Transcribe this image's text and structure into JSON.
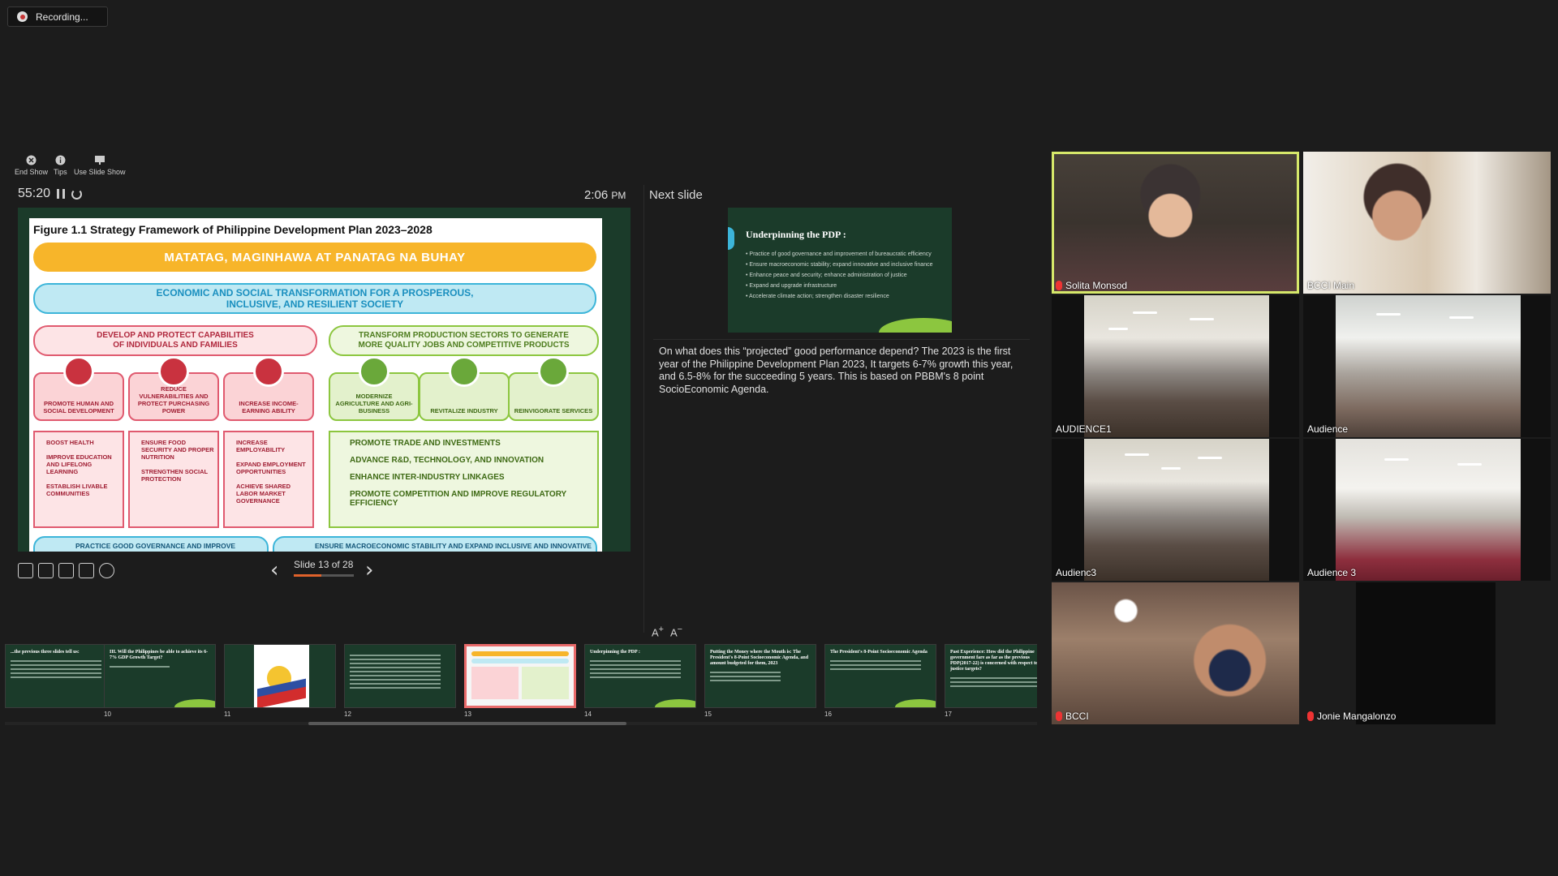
{
  "recording": {
    "label": "Recording..."
  },
  "toolbar": {
    "end_show": "End Show",
    "tips": "Tips",
    "use_slide_show": "Use Slide Show"
  },
  "timer": {
    "elapsed": "55:20"
  },
  "clock": {
    "time": "2:06",
    "ampm": "PM"
  },
  "next_slide": {
    "label": "Next slide",
    "title": "Underpinning the PDP :",
    "bullets": [
      "Practice of good governance and improvement of bureaucratic efficiency",
      "Ensure macroeconomic stability; expand innovative and inclusive finance",
      "Enhance peace and security;  enhance administration of justice",
      "Expand and upgrade infrastructure",
      "Accelerate climate action; strengthen disaster resilience"
    ]
  },
  "notes": "On what does this “projected” good performance depend?  The 2023 is the first year of the Philippine Development Plan 2023,  It targets 6-7% growth this year, and 6.5-8% for the succeeding 5 years.  This is based on PBBM's 8 point SocioEconomic Agenda.",
  "current_slide": {
    "figure_title": "Figure 1.1 Strategy Framework of Philippine Development Plan 2023–2028",
    "vision": "MATATAG, MAGINHAWA AT PANATAG NA BUHAY",
    "goal_line1": "ECONOMIC AND SOCIAL TRANSFORMATION FOR A PROSPEROUS,",
    "goal_line2": "INCLUSIVE, AND RESILIENT SOCIETY",
    "left_pillar_line1": "DEVELOP AND PROTECT CAPABILITIES",
    "left_pillar_line2": "OF INDIVIDUALS AND FAMILIES",
    "right_pillar_line1": "TRANSFORM PRODUCTION SECTORS TO GENERATE",
    "right_pillar_line2": "MORE QUALITY JOBS AND COMPETITIVE PRODUCTS",
    "categories": [
      "PROMOTE HUMAN AND SOCIAL DEVELOPMENT",
      "REDUCE VULNERABILITIES AND PROTECT PURCHASING POWER",
      "INCREASE INCOME-EARNING ABILITY",
      "MODERNIZE AGRICULTURE AND AGRI-BUSINESS",
      "REVITALIZE INDUSTRY",
      "REINVIGORATE SERVICES"
    ],
    "box1": [
      "BOOST HEALTH",
      "IMPROVE EDUCATION AND LIFELONG LEARNING",
      "ESTABLISH LIVABLE COMMUNITIES"
    ],
    "box2": [
      "ENSURE FOOD SECURITY AND PROPER NUTRITION",
      "STRENGTHEN SOCIAL PROTECTION"
    ],
    "box3": [
      "INCREASE EMPLOYABILITY",
      "EXPAND EMPLOYMENT OPPORTUNITIES",
      "ACHIEVE SHARED LABOR MARKET GOVERNANCE"
    ],
    "box_right": [
      "PROMOTE TRADE AND INVESTMENTS",
      "ADVANCE R&D, TECHNOLOGY, AND INNOVATION",
      "ENHANCE INTER-INDUSTRY LINKAGES",
      "PROMOTE COMPETITION AND IMPROVE REGULATORY EFFICIENCY"
    ],
    "bottom_left": "PRACTICE GOOD GOVERNANCE AND IMPROVE BUREAUCRATIC EFFICIENCY",
    "bottom_right": "ENSURE MACROECONOMIC STABILITY AND EXPAND INCLUSIVE AND INNOVATIVE FINANCE"
  },
  "navigation": {
    "counter": "Slide 13 of 28",
    "progress_fraction": 0.464
  },
  "filmstrip": [
    {
      "num": "",
      "title": "...the previous three slides tell us:"
    },
    {
      "num": "10",
      "title": "III. Will the Philippines be able to achieve its 6-7% GDP Growth Target?"
    },
    {
      "num": "11",
      "title": ""
    },
    {
      "num": "12",
      "title": ""
    },
    {
      "num": "13",
      "title": ""
    },
    {
      "num": "14",
      "title": "Underpinning the PDP :"
    },
    {
      "num": "15",
      "title": "Putting the Money where the Mouth is: The President's 8-Point Socioeconomic Agenda, and amount budgeted for them, 2023"
    },
    {
      "num": "16",
      "title": "The President's 8-Point Socioeconomic Agenda"
    },
    {
      "num": "17",
      "title": "Past Experience: How did the Philippine government fare as far as the previous PDP(2017-22) is concerned with respect to justice targets?"
    }
  ],
  "participants": [
    {
      "name": "Solita Monsod",
      "muted": true,
      "active": true
    },
    {
      "name": "BCCI Main",
      "muted": false,
      "active": false
    },
    {
      "name": "AUDIENCE1",
      "muted": false,
      "active": false
    },
    {
      "name": "Audience",
      "muted": false,
      "active": false
    },
    {
      "name": "Audienc3",
      "muted": false,
      "active": false
    },
    {
      "name": "Audience 3",
      "muted": false,
      "active": false
    },
    {
      "name": "BCCI",
      "muted": true,
      "active": false
    },
    {
      "name": "Jonie Mangalonzo",
      "muted": true,
      "active": false
    }
  ],
  "colors": {
    "active_speaker": "#d6e86a",
    "progress": "#e0622b",
    "slide_bg": "#1b3b2a",
    "selected_thumb": "#e86a6a"
  }
}
